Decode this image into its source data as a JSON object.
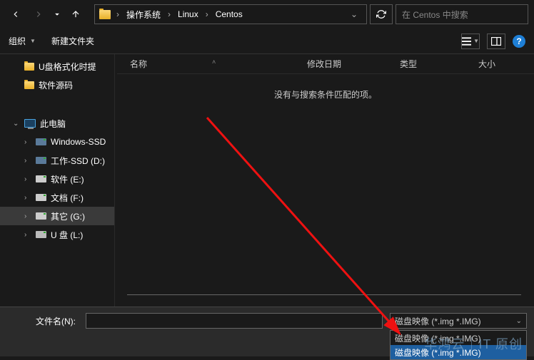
{
  "nav": {
    "path_segments": [
      "操作系统",
      "Linux",
      "Centos"
    ],
    "search_placeholder": "在 Centos 中搜索"
  },
  "toolbar": {
    "organize": "组织",
    "new_folder": "新建文件夹",
    "help_glyph": "?"
  },
  "sidebar": {
    "quick": [
      {
        "label": "U盘格式化时提"
      },
      {
        "label": "软件源码"
      }
    ],
    "this_pc": "此电脑",
    "drives": [
      {
        "label": "Windows-SSD",
        "kind": "ssd"
      },
      {
        "label": "工作-SSD (D:)",
        "kind": "ssd"
      },
      {
        "label": "软件 (E:)",
        "kind": "hdd"
      },
      {
        "label": "文档 (F:)",
        "kind": "hdd"
      },
      {
        "label": "其它 (G:)",
        "kind": "hdd",
        "active": true
      },
      {
        "label": "U 盘 (L:)",
        "kind": "usb"
      }
    ]
  },
  "columns": {
    "name": "名称",
    "date": "修改日期",
    "type": "类型",
    "size": "大小"
  },
  "filelist": {
    "empty_message": "没有与搜索条件匹配的项。"
  },
  "bottom": {
    "filename_label": "文件名(N):",
    "filter_selected": "磁盘映像 (*.img *.IMG)",
    "filter_options": [
      "磁盘映像 (*.img *.IMG)"
    ]
  },
  "watermark": "华鸿云｜IT 原创"
}
